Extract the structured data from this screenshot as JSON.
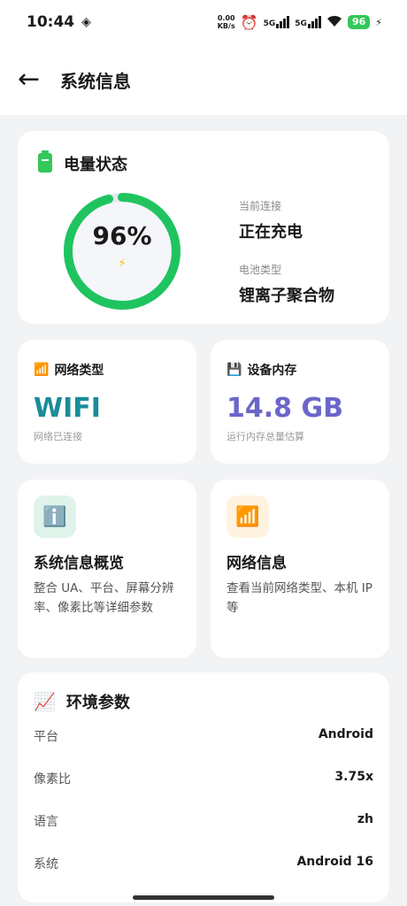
{
  "status_bar": {
    "time": "10:44",
    "net_speed_value": "0.00",
    "net_speed_unit": "KB/s",
    "signal1": "5G",
    "signal2": "5G",
    "battery": "96"
  },
  "app_bar": {
    "back_label": "←",
    "title": "系统信息"
  },
  "battery_card": {
    "title": "电量状态",
    "percent": "96%",
    "percent_value": 0.96,
    "charging_symbol": "⚡",
    "connection_label": "当前连接",
    "connection_value": "正在充电",
    "battery_type_label": "电池类型",
    "battery_type_value": "锂离子聚合物",
    "ring_color": "#1fc45f"
  },
  "network_card": {
    "title": "网络类型",
    "value": "WIFI",
    "subtitle": "网络已连接",
    "value_color": "#1a8c99"
  },
  "memory_card": {
    "title": "设备内存",
    "value": "14.8 GB",
    "subtitle": "运行内存总量估算",
    "value_color": "#6b66c9"
  },
  "tiles": [
    {
      "icon": "ℹ️",
      "title": "系统信息概览",
      "desc": "整合 UA、平台、屏幕分辨率、像素比等详细参数"
    },
    {
      "icon": "📶",
      "title": "网络信息",
      "desc": "查看当前网络类型、本机 IP 等"
    }
  ],
  "env_card": {
    "title": "环境参数",
    "rows": [
      {
        "label": "平台",
        "value": "Android"
      },
      {
        "label": "像素比",
        "value": "3.75x"
      },
      {
        "label": "语言",
        "value": "zh"
      },
      {
        "label": "系统",
        "value": "Android 16"
      }
    ]
  },
  "colors": {
    "background": "#f2f3f5",
    "card": "#ffffff",
    "battery_green": "#34c759"
  }
}
